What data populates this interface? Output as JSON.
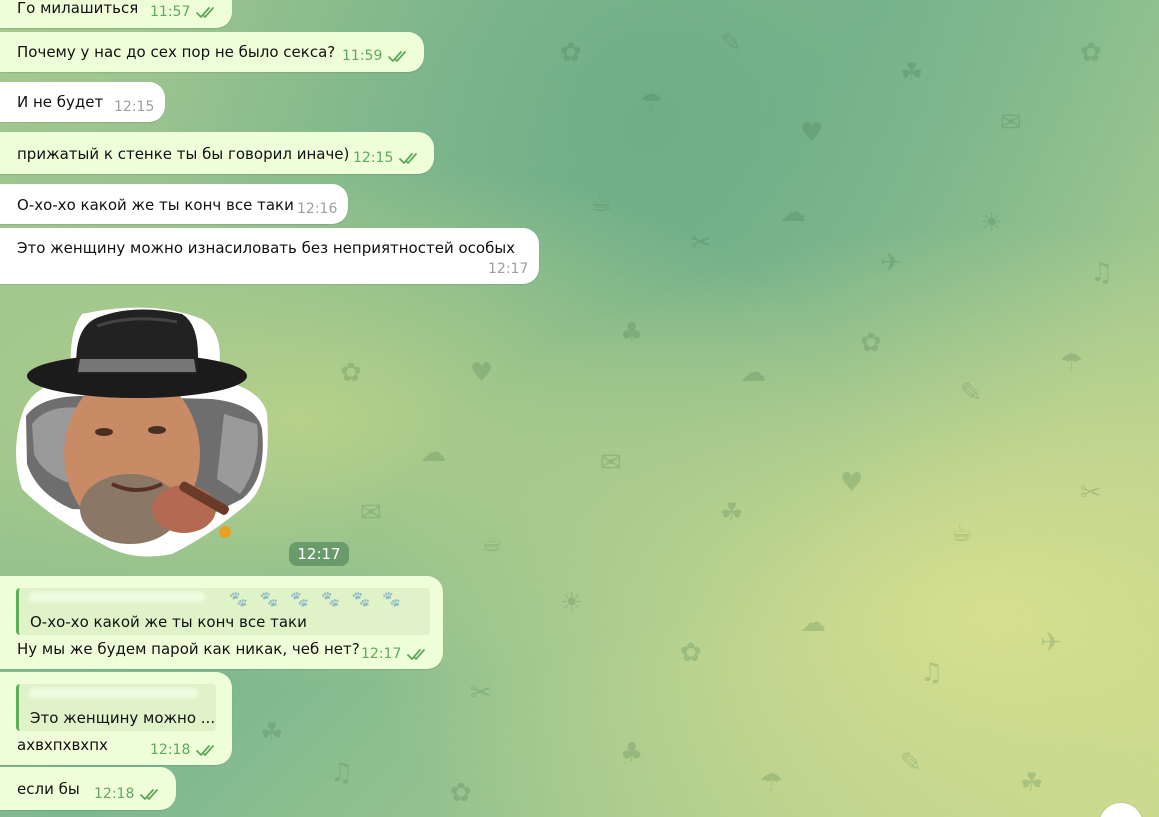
{
  "messages": [
    {
      "text": "Го милашиться",
      "time": "11:57"
    },
    {
      "text": "Почему у нас до сех пор не было секса?",
      "time": "11:59"
    },
    {
      "text": "И не будет",
      "time": "12:15"
    },
    {
      "text": "прижатый к стенке ты бы говорил иначе)",
      "time": "12:15"
    },
    {
      "text": "О-хо-хо какой же ты конч все таки",
      "time": "12:16"
    },
    {
      "text": "Это женщину можно изнасиловать без неприятностей особых",
      "time": "12:17"
    },
    {
      "reply_quote": "О-хо-хо какой же ты конч все таки",
      "text": "Ну мы же будем парой как никак, чеб нет?",
      "time": "12:17"
    },
    {
      "reply_quote": "Это женщину можно ...",
      "text": "ахвхпхвхпх",
      "time": "12:18"
    },
    {
      "text": "если бы",
      "time": "12:18"
    }
  ],
  "sticker": {
    "time": "12:17",
    "icon": "man-in-fedora-with-cigar-sticker"
  },
  "colors": {
    "outgoing_bubble": "#eefed9",
    "incoming_bubble": "#ffffff",
    "read_check": "#61a85d",
    "wallpaper": "#8fbf8c"
  }
}
